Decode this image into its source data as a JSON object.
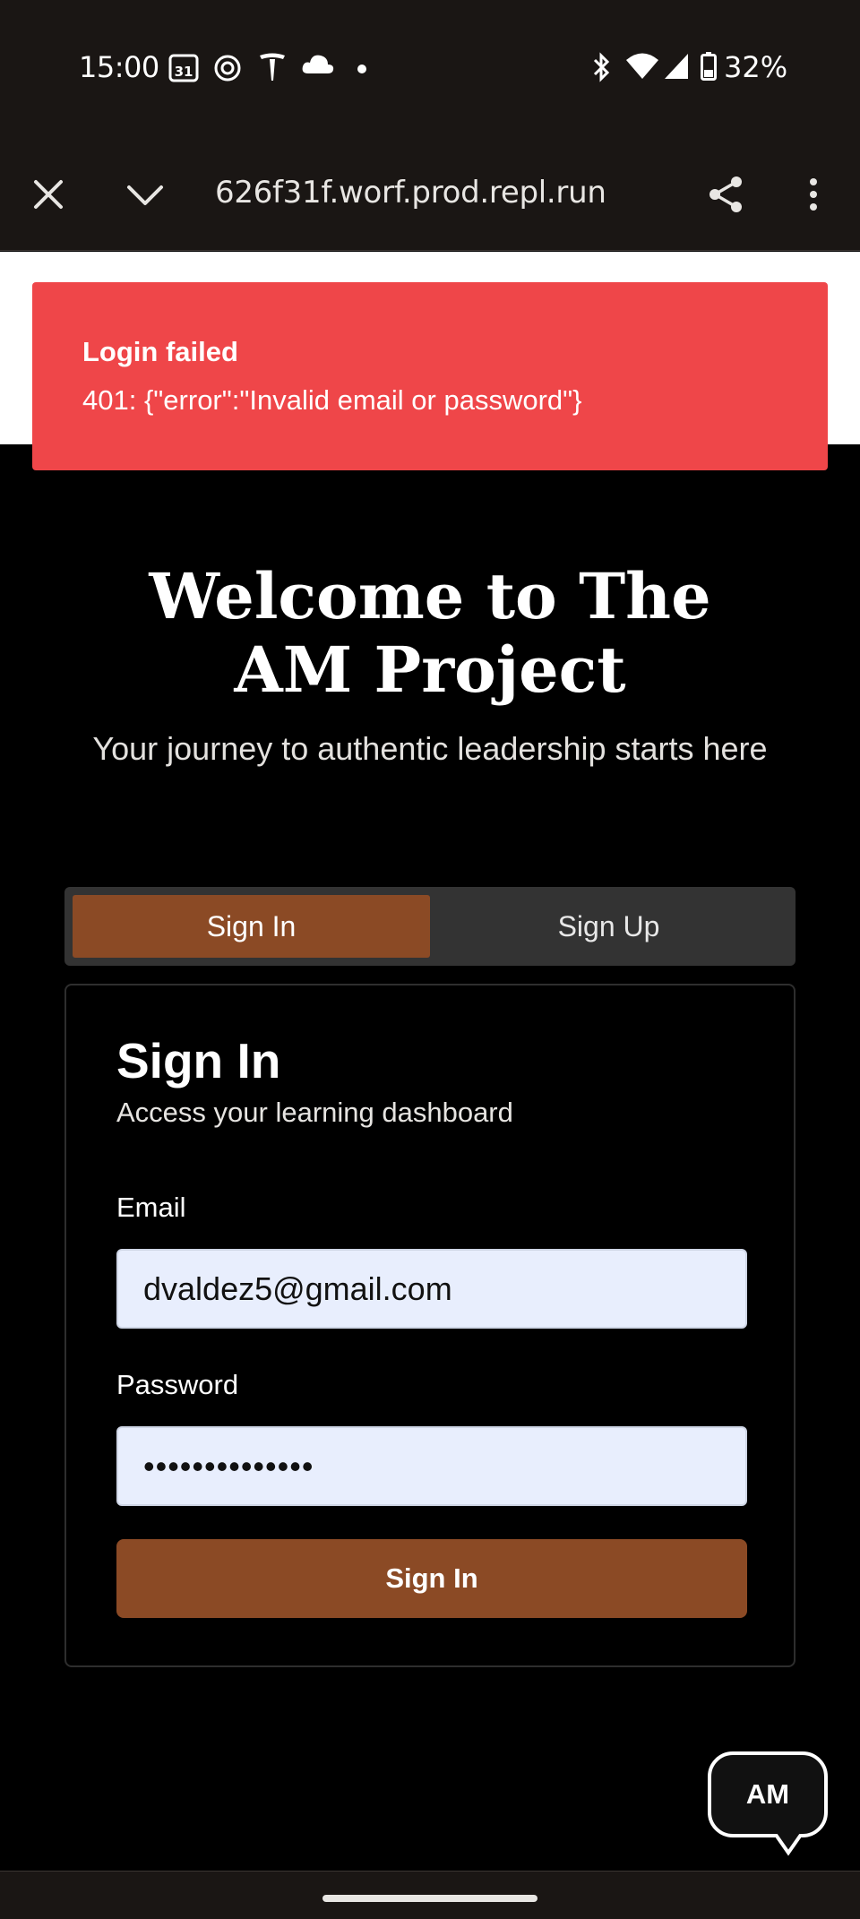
{
  "status_bar": {
    "time": "15:00",
    "calendar_day": "31",
    "battery_percent": "32%",
    "icons": [
      "calendar-icon",
      "openai-icon",
      "tesla-icon",
      "cloud-icon",
      "dot-icon",
      "bluetooth-icon",
      "wifi-icon",
      "cell-signal-icon",
      "battery-icon"
    ]
  },
  "browser": {
    "url": "626f31f.worf.prod.repl.run",
    "icons": [
      "close-icon",
      "chevron-down-icon",
      "share-icon",
      "more-vert-icon"
    ]
  },
  "toast": {
    "title": "Login failed",
    "message": "401: {\"error\":\"Invalid email or password\"}",
    "color": "#ef4649"
  },
  "hero": {
    "title": "Welcome to The AM Project",
    "subtitle": "Your journey to authentic leadership starts here"
  },
  "tabs": [
    {
      "label": "Sign In",
      "active": true
    },
    {
      "label": "Sign Up",
      "active": false
    }
  ],
  "form": {
    "title": "Sign In",
    "subtitle": "Access your learning dashboard",
    "email_label": "Email",
    "email_value": "dvaldez5@gmail.com",
    "password_label": "Password",
    "password_value": "••••••••••••••",
    "submit_label": "Sign In"
  },
  "chat": {
    "label": "AM"
  },
  "colors": {
    "accent": "#8b4a25",
    "error": "#ef4649",
    "background": "#000000",
    "input_bg": "#e8eefd"
  }
}
